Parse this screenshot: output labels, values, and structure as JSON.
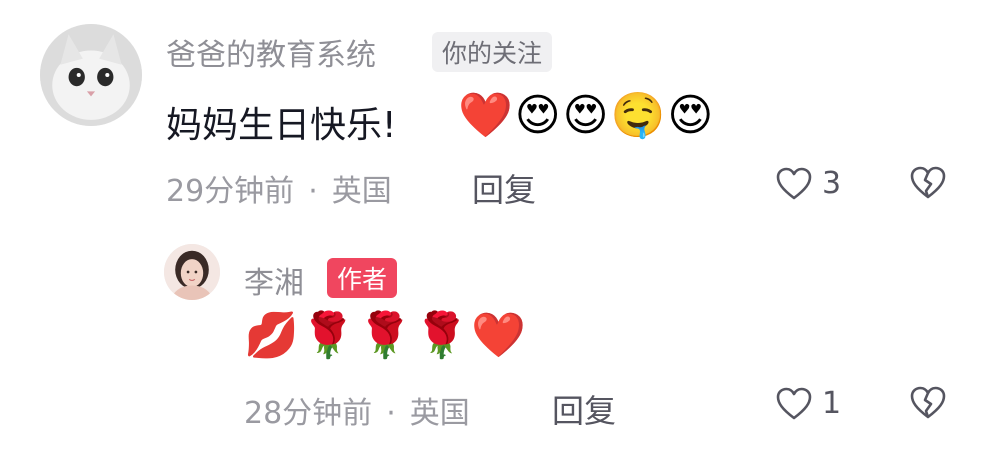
{
  "comments": [
    {
      "username": "爸爸的教育系统",
      "badge": "你的关注",
      "text": "妈妈生日快乐!",
      "emojis": [
        "❤️",
        "😍",
        "😍",
        "🤤",
        "😍"
      ],
      "time": "29分钟前",
      "separator": "·",
      "location": "英国",
      "reply_label": "回复",
      "like_count": "3"
    },
    {
      "username": "李湘",
      "badge": "作者",
      "emojis": [
        "💋",
        "🌹",
        "🌹",
        "🌹",
        "❤️"
      ],
      "time": "28分钟前",
      "separator": "·",
      "location": "英国",
      "reply_label": "回复",
      "like_count": "1"
    }
  ],
  "colors": {
    "author_badge": "#f0465f",
    "meta_text": "#9a9aa1",
    "primary_text": "#161823"
  },
  "icons": {
    "like": "heart-outline-icon",
    "dislike": "broken-heart-icon"
  }
}
